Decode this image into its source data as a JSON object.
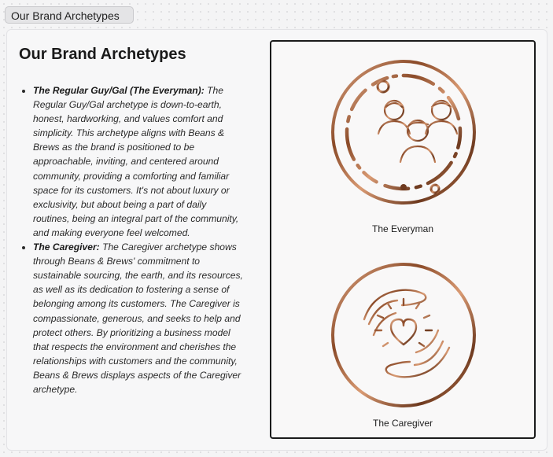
{
  "tag_label": "Our Brand Archetypes",
  "content": {
    "title": "Our Brand Archetypes",
    "archetypes": [
      {
        "name": "The Regular Guy/Gal (The Everyman):",
        "description": "The Regular Guy/Gal archetype is down-to-earth, honest, hardworking, and values comfort and simplicity. This archetype aligns with Beans & Brews as the brand is positioned to be approachable, inviting, and centered around community, providing a comforting and familiar space for its customers. It's not about luxury or exclusivity, but about being a part of daily routines, being an integral part of the community, and making everyone feel welcomed."
      },
      {
        "name": "The Caregiver:",
        "description": "The Caregiver archetype shows through Beans & Brews' commitment to sustainable sourcing, the earth, and its resources, as well as its dedication to fostering a sense of belonging among its customers. The Caregiver is compassionate, generous, and seeks to help and protect others. By prioritizing a business model that respects the environment and cherishes the relationships with customers and the community, Beans & Brews displays aspects of the Caregiver archetype."
      }
    ]
  },
  "images": [
    {
      "caption": "The Everyman",
      "icon": "three-people-icon"
    },
    {
      "caption": "The Caregiver",
      "icon": "hands-holding-heart-icon"
    }
  ],
  "colors": {
    "copper_dark": "#6e3a1f",
    "copper_mid": "#b0673c",
    "copper_light": "#e8b08c"
  }
}
